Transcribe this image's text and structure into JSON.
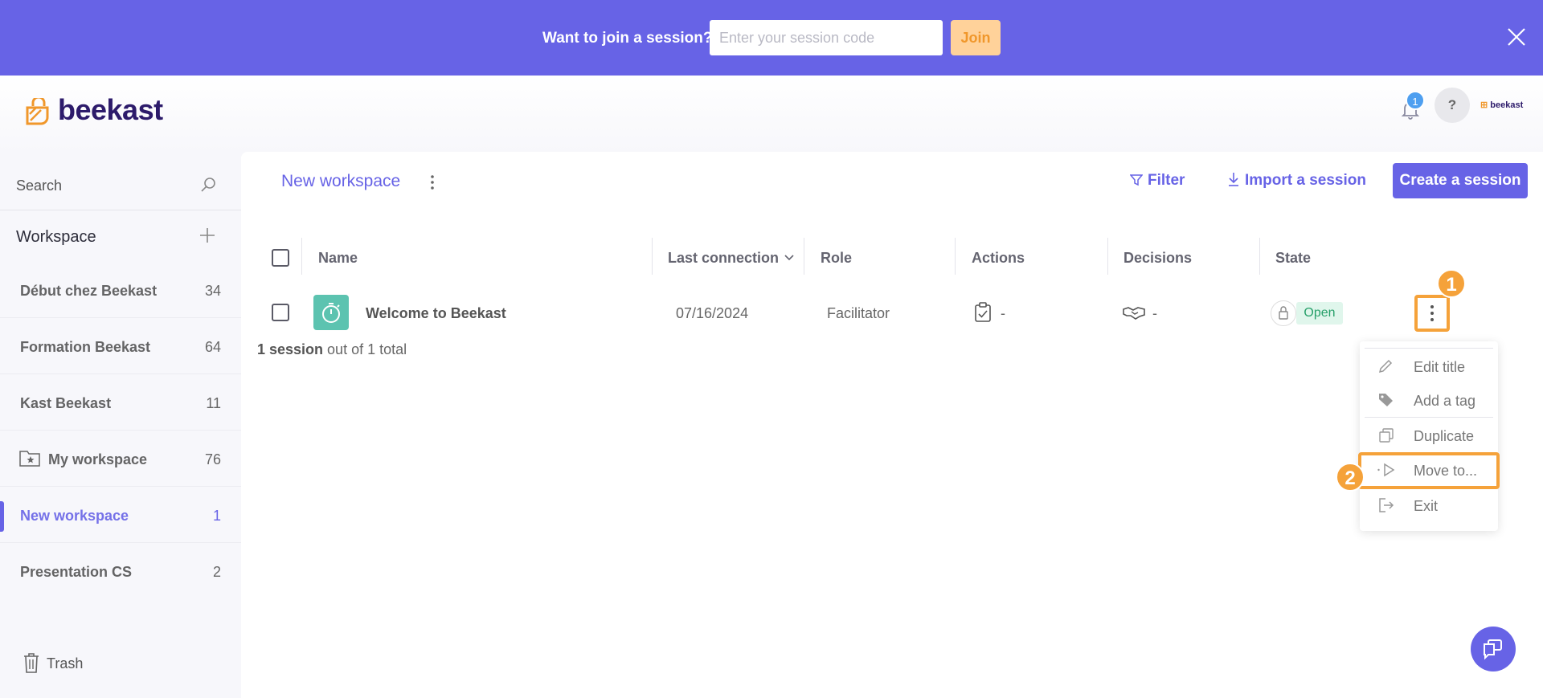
{
  "banner": {
    "prompt": "Want to join a session?",
    "input_placeholder": "Enter your session code",
    "join_label": "Join"
  },
  "header": {
    "logo_text": "beekast",
    "notification_count": "1",
    "help_label": "?",
    "brand_mini": "beekast"
  },
  "sidebar": {
    "search_label": "Search",
    "workspace_header": "Workspace",
    "items": [
      {
        "name": "Début chez Beekast",
        "count": "34"
      },
      {
        "name": "Formation Beekast",
        "count": "64"
      },
      {
        "name": "Kast Beekast",
        "count": "11"
      },
      {
        "name": "My workspace",
        "count": "76"
      },
      {
        "name": "New workspace",
        "count": "1"
      },
      {
        "name": "Presentation CS",
        "count": "2"
      }
    ],
    "trash_label": "Trash"
  },
  "main": {
    "title": "New workspace",
    "filter_label": "Filter",
    "import_label": "Import a session",
    "create_label": "Create a session",
    "columns": [
      "Name",
      "Last connection",
      "Role",
      "Actions",
      "Decisions",
      "State"
    ],
    "rows": [
      {
        "name": "Welcome to Beekast",
        "last_connection": "07/16/2024",
        "role": "Facilitator",
        "actions": "-",
        "decisions": "-",
        "state": "Open"
      }
    ],
    "summary_bold": "1 session",
    "summary_rest": " out of 1 total"
  },
  "menu": {
    "items": [
      "Edit title",
      "Add a tag",
      "Duplicate",
      "Move to...",
      "Exit"
    ]
  },
  "annotations": [
    "1",
    "2"
  ],
  "colors": {
    "accent": "#6763e6",
    "highlight": "#f5a23a",
    "open_state": "#27a06a",
    "thumb": "#5cc3b0"
  }
}
